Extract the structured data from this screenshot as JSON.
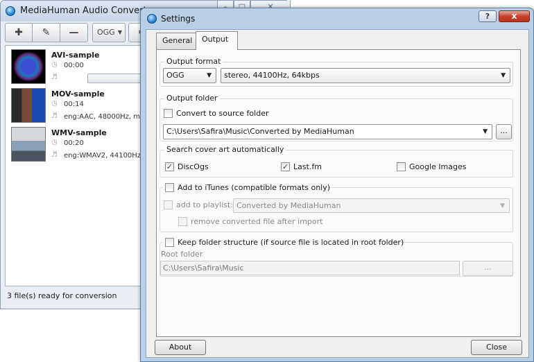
{
  "main": {
    "title": "MediaHuman Audio Converter",
    "toolbar": {
      "format": "OGG"
    },
    "files": [
      {
        "name": "AVI-sample",
        "duration": "00:00",
        "details": ""
      },
      {
        "name": "MOV-sample",
        "duration": "00:14",
        "details": "eng:AAC, 48000Hz, mono"
      },
      {
        "name": "WMV-sample",
        "duration": "00:20",
        "details": "eng:WMAV2, 44100Hz, mo"
      }
    ],
    "status": "3 file(s) ready for conversion"
  },
  "dialog": {
    "title": "Settings",
    "help": "?",
    "close_x": "x",
    "tabs": [
      "General",
      "Output"
    ],
    "output_format": {
      "legend": "Output format",
      "format": "OGG",
      "quality": "stereo, 44100Hz, 64kbps"
    },
    "output_folder": {
      "legend": "Output folder",
      "convert_to_source": "Convert to source folder",
      "convert_to_source_checked": false,
      "path": "C:\\Users\\Safira\\Music\\Converted by MediaHuman",
      "browse": "..."
    },
    "cover_art": {
      "legend": "Search cover art automatically",
      "discogs": "DiscOgs",
      "discogs_checked": true,
      "lastfm": "Last.fm",
      "lastfm_checked": true,
      "google": "Google Images",
      "google_checked": false
    },
    "itunes": {
      "legend": "Add to iTunes (compatible formats only)",
      "checked": false,
      "add_to_playlist": "add to playlist:",
      "playlist_value": "Converted by MediaHuman",
      "remove_after_import": "remove converted file after import"
    },
    "folder_structure": {
      "legend": "Keep folder structure (if source file is located in root folder)",
      "checked": false,
      "root_label": "Root folder",
      "root_path": "C:\\Users\\Safira\\Music",
      "browse": "..."
    },
    "footer": {
      "about": "About",
      "close": "Close"
    }
  }
}
